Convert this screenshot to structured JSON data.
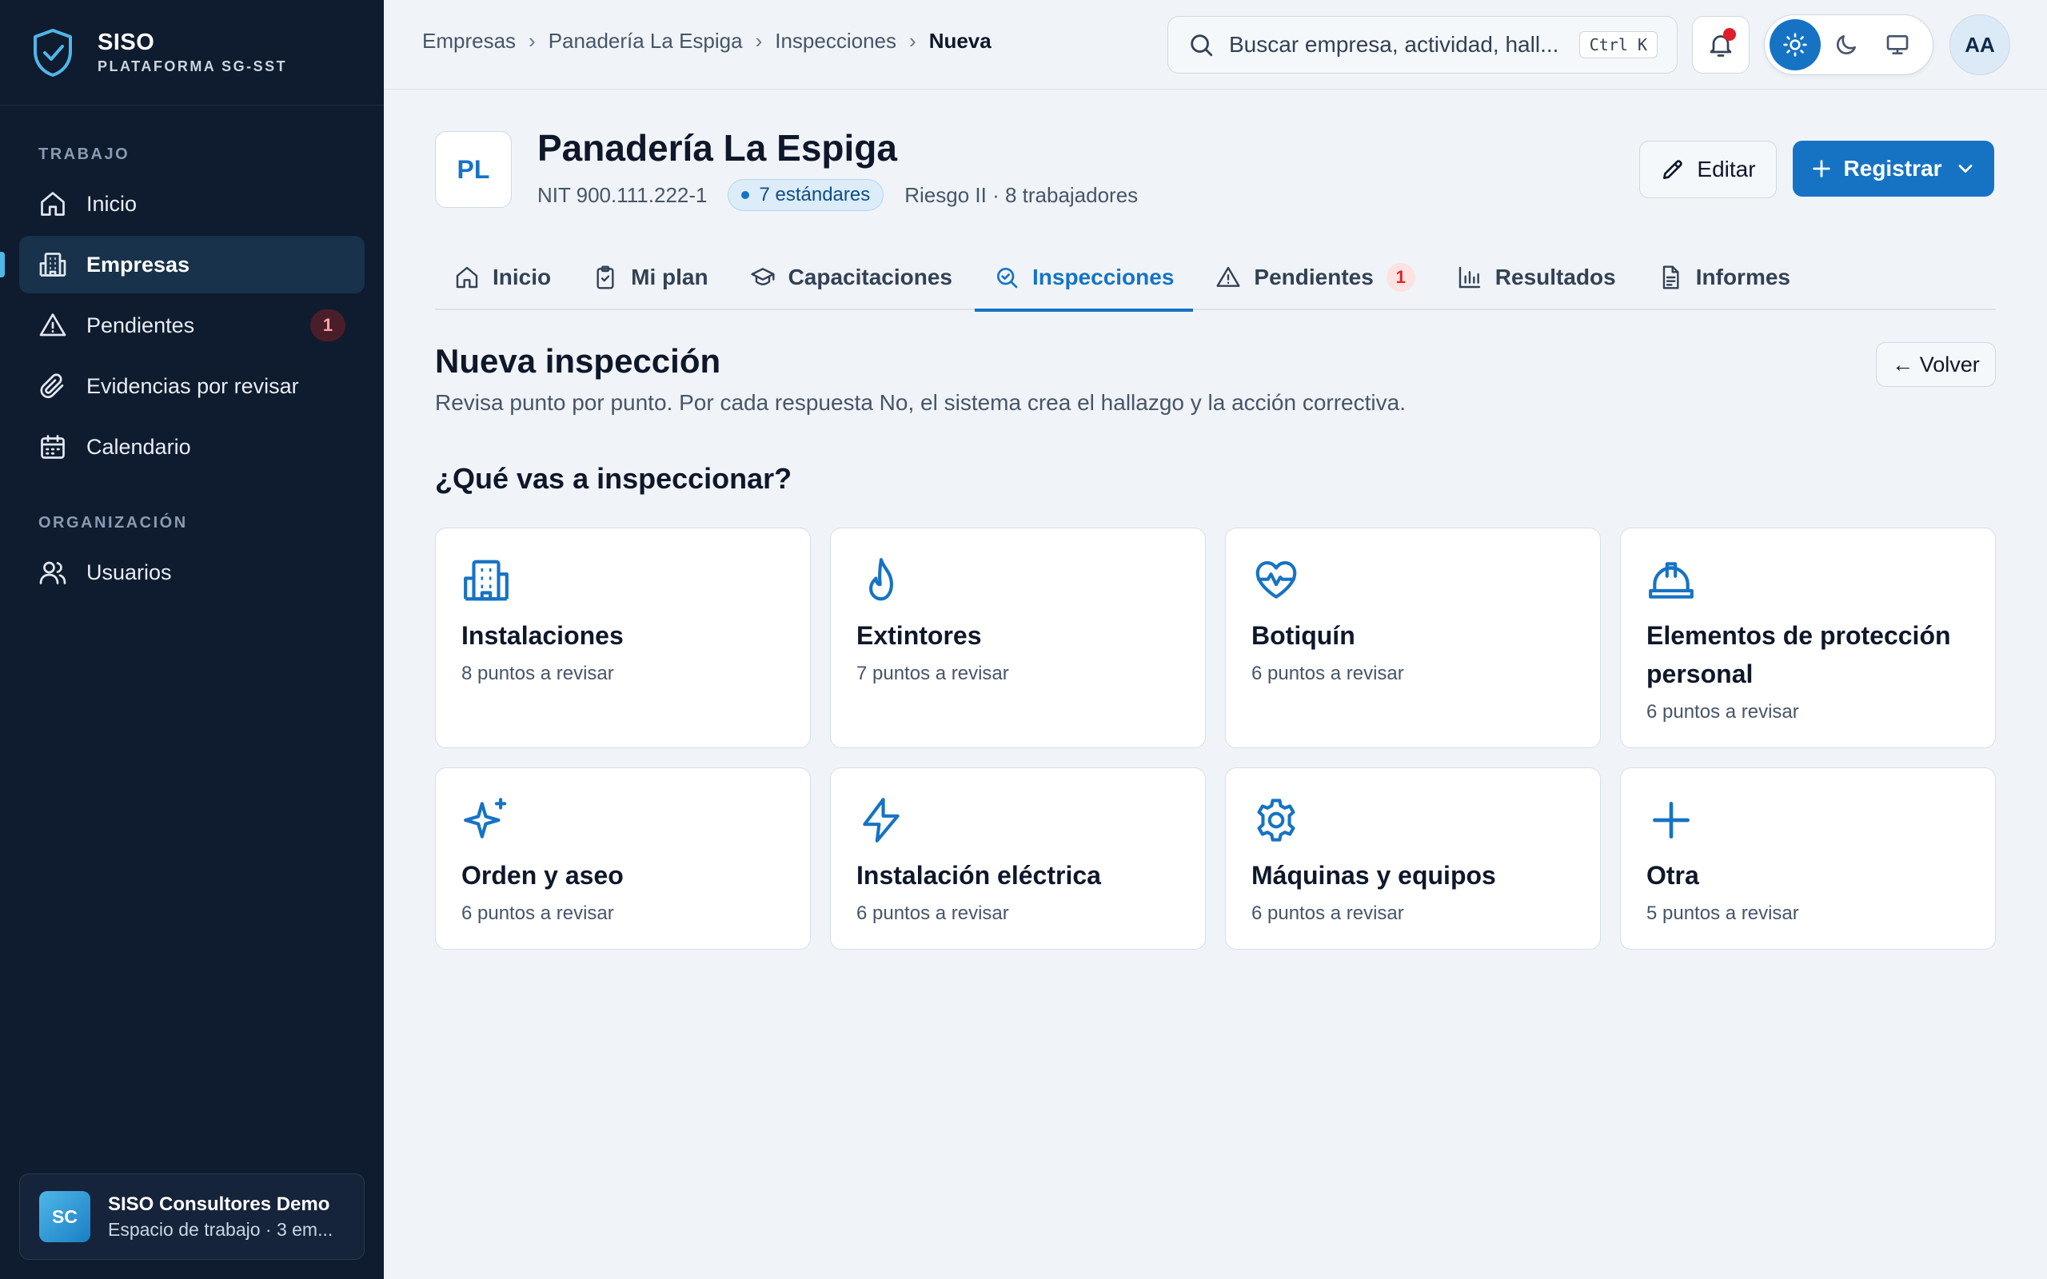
{
  "brand": {
    "name": "SISO",
    "subtitle": "PLATAFORMA SG-SST"
  },
  "sidebar": {
    "section_work": "TRABAJO",
    "section_org": "ORGANIZACIÓN",
    "items": [
      {
        "label": "Inicio",
        "icon": "home-icon"
      },
      {
        "label": "Empresas",
        "icon": "building-icon",
        "active": true
      },
      {
        "label": "Pendientes",
        "icon": "warning-icon",
        "badge": "1"
      },
      {
        "label": "Evidencias por revisar",
        "icon": "paperclip-icon"
      },
      {
        "label": "Calendario",
        "icon": "calendar-icon"
      },
      {
        "label": "Usuarios",
        "icon": "users-icon"
      }
    ],
    "workspace": {
      "initials": "SC",
      "name": "SISO Consultores Demo",
      "subtitle": "Espacio de trabajo · 3 em..."
    }
  },
  "topbar": {
    "breadcrumb": [
      "Empresas",
      "Panadería La Espiga",
      "Inspecciones",
      "Nueva"
    ],
    "search_placeholder": "Buscar empresa, actividad, hall...",
    "search_shortcut": "Ctrl K",
    "avatar": "AA"
  },
  "company": {
    "initials": "PL",
    "name": "Panadería La Espiga",
    "nit": "NIT 900.111.222-1",
    "standards": "7 estándares",
    "risk": "Riesgo II · 8 trabajadores",
    "edit_label": "Editar",
    "register_label": "Registrar"
  },
  "tabs": [
    {
      "label": "Inicio",
      "icon": "home-icon"
    },
    {
      "label": "Mi plan",
      "icon": "clipboard-icon"
    },
    {
      "label": "Capacitaciones",
      "icon": "graduation-cap-icon"
    },
    {
      "label": "Inspecciones",
      "icon": "search-check-icon",
      "active": true
    },
    {
      "label": "Pendientes",
      "icon": "warning-icon",
      "badge": "1"
    },
    {
      "label": "Resultados",
      "icon": "bar-chart-icon"
    },
    {
      "label": "Informes",
      "icon": "document-icon"
    }
  ],
  "main": {
    "title": "Nueva inspección",
    "subtitle": "Revisa punto por punto. Por cada respuesta No, el sistema crea el hallazgo y la acción correctiva.",
    "back_label": "← Volver",
    "question": "¿Qué vas a inspeccionar?",
    "cards": [
      {
        "title": "Instalaciones",
        "sub": "8 puntos a revisar",
        "icon": "building-icon"
      },
      {
        "title": "Extintores",
        "sub": "7 puntos a revisar",
        "icon": "flame-icon"
      },
      {
        "title": "Botiquín",
        "sub": "6 puntos a revisar",
        "icon": "heart-pulse-icon"
      },
      {
        "title": "Elementos de protección personal",
        "sub": "6 puntos a revisar",
        "icon": "hard-hat-icon"
      },
      {
        "title": "Orden y aseo",
        "sub": "6 puntos a revisar",
        "icon": "sparkles-icon"
      },
      {
        "title": "Instalación eléctrica",
        "sub": "6 puntos a revisar",
        "icon": "lightning-icon"
      },
      {
        "title": "Máquinas y equipos",
        "sub": "6 puntos a revisar",
        "icon": "gear-icon"
      },
      {
        "title": "Otra",
        "sub": "5 puntos a revisar",
        "icon": "plus-icon"
      }
    ]
  },
  "colors": {
    "accent": "#1673c4",
    "sidebar_bg": "#0f1b2e",
    "page_bg": "#f0f4f8",
    "alert": "#e11d2a"
  }
}
